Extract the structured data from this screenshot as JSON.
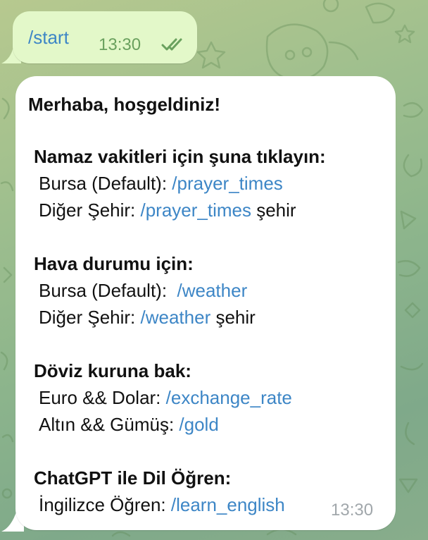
{
  "outgoing": {
    "text": "/start",
    "time": "13:30",
    "status_icon": "double-check-icon"
  },
  "incoming": {
    "greeting": "Merhaba, hoşgeldiniz!",
    "prayer": {
      "heading": "Namaz vakitleri için şuna tıklayın:",
      "default_label": "Bursa (Default): ",
      "default_link": "/prayer_times",
      "other_label": "Diğer Şehir: ",
      "other_link": "/prayer_times",
      "other_suffix": " şehir"
    },
    "weather": {
      "heading": "Hava durumu için:",
      "default_label": "Bursa (Default):  ",
      "default_link": "/weather",
      "other_label": "Diğer Şehir: ",
      "other_link": "/weather",
      "other_suffix": " şehir"
    },
    "exchange": {
      "heading": "Döviz kuruna bak:",
      "euro_label": "Euro && Dolar: ",
      "euro_link": "/exchange_rate",
      "gold_label": "Altın && Gümüş: ",
      "gold_link": "/gold"
    },
    "chatgpt": {
      "heading": "ChatGPT ile Dil Öğren:",
      "english_label": "İngilizce Öğren: ",
      "english_link": "/learn_english"
    },
    "time": "13:30"
  },
  "colors": {
    "outgoing_bubble": "#e3f8c9",
    "incoming_bubble": "#ffffff",
    "link": "#3d86c6",
    "outgoing_meta": "#6aa15e",
    "incoming_meta": "#a1a7ab"
  }
}
